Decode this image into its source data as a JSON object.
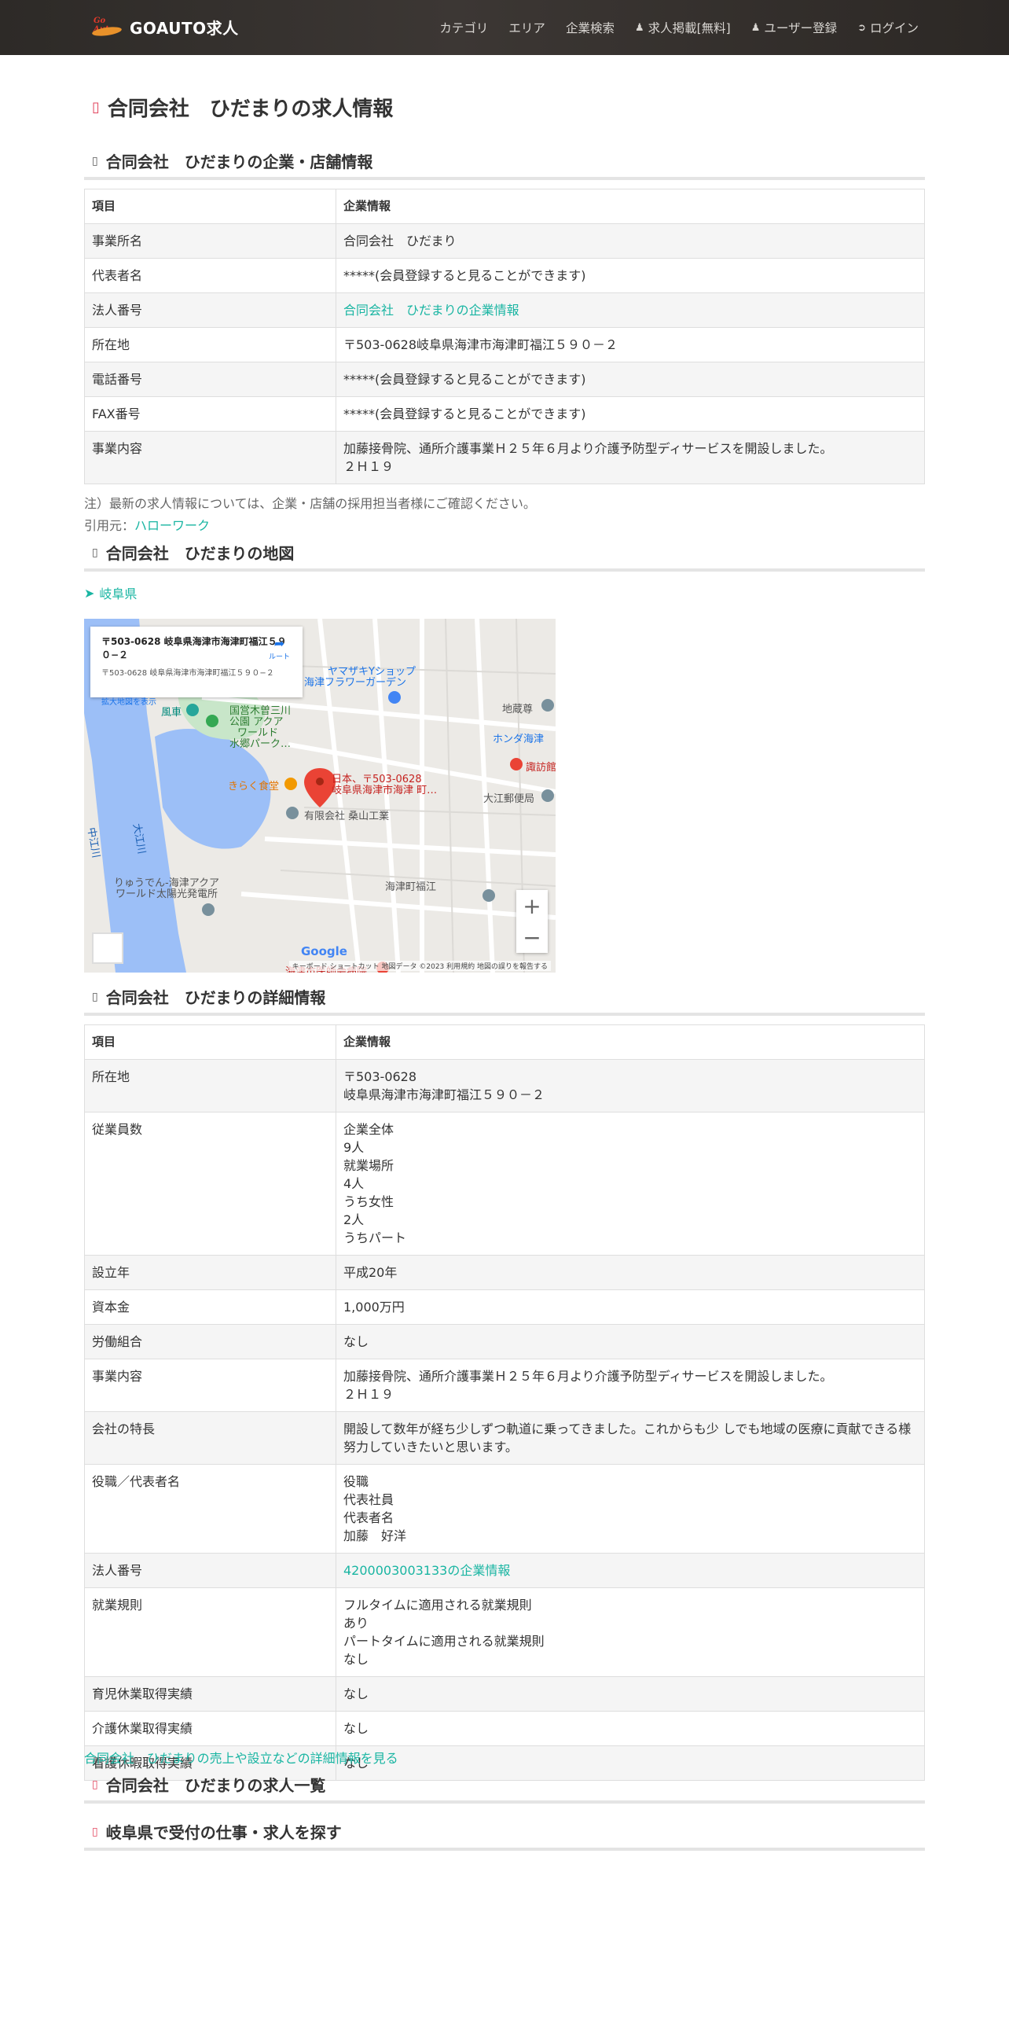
{
  "navbar": {
    "brand": "GOAUTO求人",
    "logo_text": "Go Auto",
    "items": [
      {
        "label": "カテゴリ",
        "icon": ""
      },
      {
        "label": "エリア",
        "icon": ""
      },
      {
        "label": "企業検索",
        "icon": ""
      },
      {
        "label": "求人掲載[無料]",
        "icon": "user-icon"
      },
      {
        "label": "ユーザー登録",
        "icon": "user-icon"
      },
      {
        "label": "ログイン",
        "icon": "login-icon"
      }
    ]
  },
  "page_title": "合同会社　ひだまりの求人情報",
  "company_section": {
    "title": "合同会社　ひだまりの企業・店舗情報",
    "header": [
      "項目",
      "企業情報"
    ],
    "rows": [
      [
        "事業所名",
        "合同会社　ひだまり"
      ],
      [
        "代表者名",
        "*****(会員登録すると見ることができます)"
      ],
      [
        "法人番号",
        "合同会社　ひだまりの企業情報"
      ],
      [
        "所在地",
        "〒503-0628岐阜県海津市海津町福江５９０－２"
      ],
      [
        "電話番号",
        "*****(会員登録すると見ることができます)"
      ],
      [
        "FAX番号",
        "*****(会員登録すると見ることができます)"
      ],
      [
        "事業内容",
        "加藤接骨院、通所介護事業Ｈ２５年６月より介護予防型ディサービスを開設しました。\n２Ｈ１９"
      ]
    ]
  },
  "note": "注）最新の求人情報については、企業・店舗の採用担当者様にご確認ください。",
  "source_label": "引用元：",
  "source_link": "ハローワーク",
  "map_section": {
    "title": "合同会社　ひだまりの地図",
    "pref_link": "岐阜県",
    "card_title": "〒503-0628 岐阜県海津市海津町福江５９０−２",
    "card_sub": "〒503-0628 岐阜県海津市海津町福江５９０−２",
    "card_link": "拡大地図を表示",
    "route_label": "ルート",
    "labels": [
      "ヤマザキYショップ",
      "海津フラワーガーデン",
      "国営木曽三川",
      "公園 アクア",
      "ワールド",
      "水郷パーク…",
      "風車",
      "地蔵尊",
      "ホンダ海津",
      "諏訪館",
      "大江郵便局",
      "きらく食堂",
      "有限会社 桑山工業",
      "日本、〒503-0628",
      "岐阜県海津市海津 町…",
      "大江川",
      "中江川",
      "海津町福江",
      "りゅうでん‐海津アクア",
      "ワールド太陽光発電所",
      "海津市医師会病院"
    ],
    "footer": "キーボード ショートカット  地図データ ©2023  利用規約  地図の誤りを報告する",
    "google": "Google",
    "zoom_in": "+",
    "zoom_out": "−"
  },
  "detail_section": {
    "title": "合同会社　ひだまりの詳細情報",
    "header": [
      "項目",
      "企業情報"
    ],
    "rows": [
      [
        "所在地",
        "〒503-0628\n岐阜県海津市海津町福江５９０－２"
      ],
      [
        "従業員数",
        "企業全体\n9人\n就業場所\n4人\nうち女性\n2人\nうちパート"
      ],
      [
        "設立年",
        "平成20年"
      ],
      [
        "資本金",
        "1,000万円"
      ],
      [
        "労働組合",
        "なし"
      ],
      [
        "事業内容",
        "加藤接骨院、通所介護事業Ｈ２５年６月より介護予防型ディサービスを開設しました。\n２Ｈ１９"
      ],
      [
        "会社の特長",
        "開設して数年が経ち少しずつ軌道に乗ってきました。これからも少 しでも地域の医療に貢献できる様\n努力していきたいと思います。"
      ],
      [
        "役職／代表者名",
        "役職\n代表社員\n代表者名\n加藤　好洋"
      ],
      [
        "法人番号",
        "4200003003133の企業情報"
      ],
      [
        "就業規則",
        "フルタイムに適用される就業規則\nあり\nパートタイムに適用される就業規則\nなし"
      ],
      [
        "育児休業取得実績",
        "なし"
      ],
      [
        "介護休業取得実績",
        "なし"
      ],
      [
        "看護休暇取得実績",
        "なし"
      ]
    ]
  },
  "detail_link": "合同会社　ひだまりの売上や設立などの詳細情報を見る",
  "jobs_section": {
    "title": "合同会社　ひだまりの求人一覧"
  },
  "search_section": {
    "title": "岐阜県で受付の仕事・求人を探す"
  },
  "colors": {
    "accent": "#19b5a2",
    "bullet": "#e2455e",
    "navbar": "#2d2a27"
  }
}
